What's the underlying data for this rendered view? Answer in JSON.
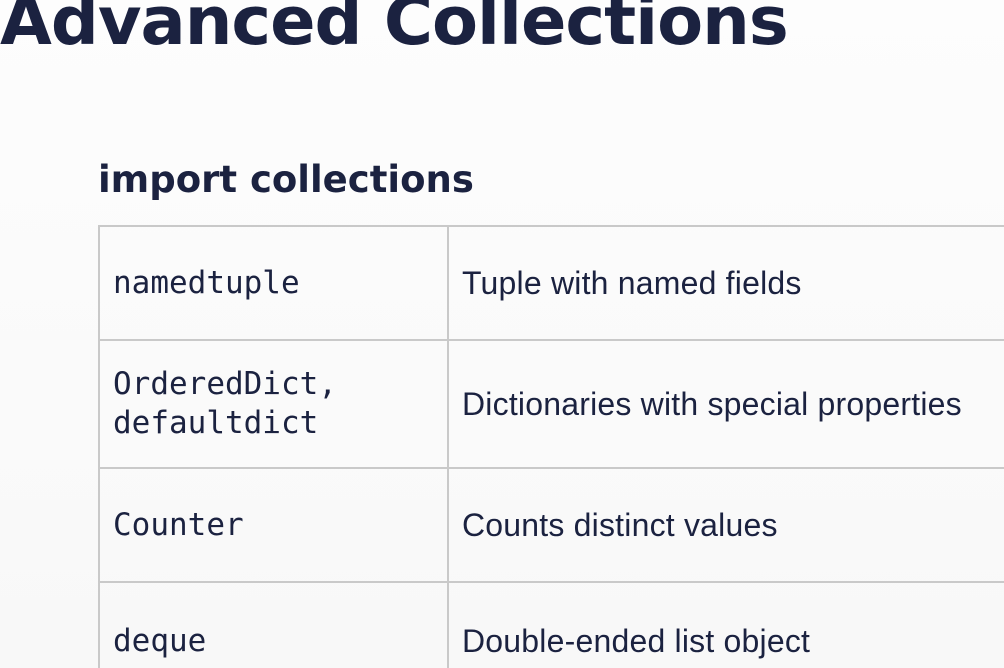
{
  "slide": {
    "title": "Advanced Collections",
    "subtitle": "import collections"
  },
  "table": {
    "rows": [
      {
        "name_lines": [
          "namedtuple"
        ],
        "description": "Tuple with named fields"
      },
      {
        "name_lines": [
          "OrderedDict,",
          "defaultdict"
        ],
        "description": "Dictionaries with special properties"
      },
      {
        "name_lines": [
          "Counter"
        ],
        "description": "Counts distinct values"
      },
      {
        "name_lines": [
          "deque"
        ],
        "description": "Double-ended list object"
      }
    ]
  },
  "colors": {
    "text": "#1b2240",
    "border": "#c9c9c9",
    "background": "#fcfcfc"
  }
}
